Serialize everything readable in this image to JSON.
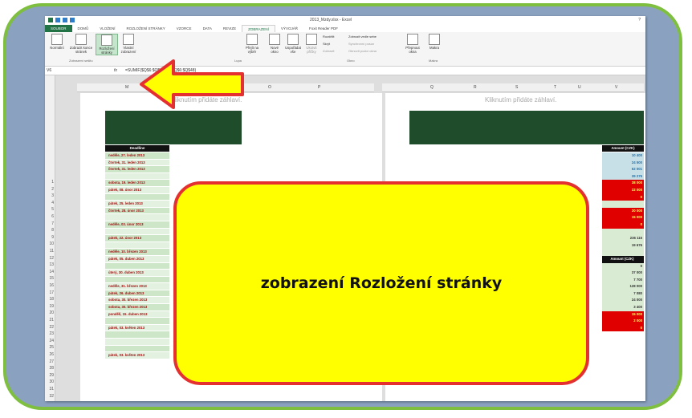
{
  "window": {
    "title": "2013_Mzdy.xlsx - Excel",
    "help": "?"
  },
  "tabs": [
    {
      "label": "SOUBOR",
      "state": "file"
    },
    {
      "label": "DOMŮ",
      "state": ""
    },
    {
      "label": "VLOŽENÍ",
      "state": ""
    },
    {
      "label": "ROZLOŽENÍ STRÁNKY",
      "state": ""
    },
    {
      "label": "VZORCE",
      "state": ""
    },
    {
      "label": "DATA",
      "state": ""
    },
    {
      "label": "REVIZE",
      "state": ""
    },
    {
      "label": "ZOBRAZENÍ",
      "state": "active"
    },
    {
      "label": "VÝVOJÁŘ",
      "state": ""
    },
    {
      "label": "Foxit Reader PDF",
      "state": ""
    }
  ],
  "ribbon": {
    "normal": "Normální",
    "page_break": "Zobrazit konce stránek",
    "page_layout": "Rozložení stránky",
    "custom": "Vlastní zobrazení",
    "group_views": "Zobrazení sešitu",
    "goto_select": "Přejít na výběr",
    "group_zoom": "Lupa",
    "new_window": "Nové okno",
    "arrange": "Uspořádat vše",
    "freeze": "Ukotvit příčky",
    "split": "Rozdělit",
    "hide": "Skrýt",
    "unhide": "Zobrazit",
    "side_by_side": "Zobrazit vedle sebe",
    "sync_scroll": "Synchronní posun",
    "reset_pos": "Obnovit pozici okna",
    "switch": "Přepnout okna",
    "group_window": "Okno",
    "macros": "Makra",
    "group_macros": "Makra"
  },
  "formula": {
    "name_box": "V6",
    "fx": "fx",
    "content": "=SUMIF($Q$6:$Q$48;U6;$Q$6:$Q$48)"
  },
  "columns_left": [
    "M",
    "N",
    "O",
    "P"
  ],
  "columns_right": [
    "Q",
    "R",
    "S",
    "T",
    "U",
    "V"
  ],
  "header_placeholder": "Kliknutím přidáte záhlaví.",
  "table": {
    "deadline_header": "Deadline",
    "amount_header": "Amount (CZK)",
    "row_numbers": [
      "1",
      "2",
      "3",
      "4",
      "5",
      "6",
      "7",
      "8",
      "9",
      "10",
      "11",
      "12",
      "13",
      "14",
      "15",
      "16",
      "17",
      "18",
      "19",
      "20",
      "21",
      "22",
      "23",
      "24",
      "25",
      "26",
      "27",
      "28",
      "29",
      "30",
      "31",
      "32"
    ],
    "deadlines": [
      "neděle, 27. leden 2013",
      "čtvrtek, 31. leden 2013",
      "čtvrtek, 31. leden 2013",
      "",
      "sobota, 19. leden 2013",
      "pátek, 08. únor 2013",
      "",
      "pátek, 25. leden 2013",
      "čtvrtek, 28. únor 2013",
      "",
      "neděle, 03. únor 2013",
      "",
      "pátek, 22. únor 2013",
      "",
      "neděle, 10. březen 2013",
      "pátek, 05. duben 2013",
      "",
      "úterý, 30. duben 2013",
      "",
      "neděle, 31. březen 2013",
      "pátek, 26. duben 2013",
      "sobota, 30. březen 2013",
      "sobota, 30. březen 2013",
      "pondělí, 15. duben 2013",
      "",
      "pátek, 03. květen 2013",
      "",
      "",
      "",
      "pátek, 03. květen 2013"
    ],
    "amounts": [
      "10 400",
      "24 500",
      "62 001",
      "39 275",
      "38 000",
      "22 000",
      "0",
      "",
      "20 000",
      "15 000",
      "0",
      "",
      "236 115",
      "19 676",
      "",
      "Amount (CZK)",
      "0",
      "37 000",
      "7 700",
      "128 000",
      "7 080",
      "24 000",
      "3 400",
      "15 000",
      "2 000",
      "0"
    ]
  },
  "callout": {
    "text": "zobrazení Rozložení stránky"
  },
  "colors": {
    "frame_border": "#7fbf3f",
    "callout_fill": "#ffff00",
    "callout_border": "#e53030",
    "excel_green": "#217346"
  }
}
